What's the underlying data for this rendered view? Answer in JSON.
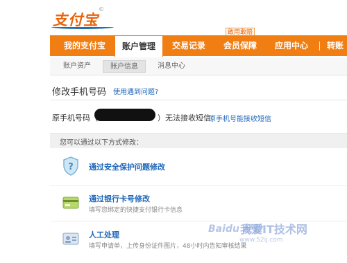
{
  "brand": {
    "logo_text": "支付宝",
    "logo_mark": "©"
  },
  "nav": {
    "items": [
      "我的支付宝",
      "账户管理",
      "交易记录",
      "会员保障",
      "应用中心",
      "转账"
    ],
    "active_index": 1,
    "badge": "敢用敢赔"
  },
  "subnav": {
    "items": [
      "账户资产",
      "账户信息",
      "消息中心"
    ],
    "active_index": 1
  },
  "page": {
    "title": "修改手机号码",
    "help_link": "使用遇到问题?",
    "orig_label": "原手机号码（",
    "orig_status": "）无法接收短信",
    "orig_link": "原手机号能接收短信"
  },
  "methods": {
    "header": "您可以通过以下方式修改：",
    "options": [
      {
        "title": "通过安全保护问题修改",
        "desc": "",
        "icon": "shield-icon"
      },
      {
        "title": "通过银行卡号修改",
        "desc": "填写您绑定的快捷支付银行卡信息",
        "icon": "bank-card-icon"
      },
      {
        "title": "人工处理",
        "desc": "填写申请单，上传身份证件图片，48小时内告知审核结果",
        "icon": "id-card-icon"
      }
    ]
  },
  "watermark": {
    "text1": "Baidu 经验",
    "text2": "我爱IT技术网",
    "text3": "www.52ij.com"
  },
  "colors": {
    "accent": "#f07e12",
    "link": "#1f67b8",
    "logo": "#e8650e"
  }
}
